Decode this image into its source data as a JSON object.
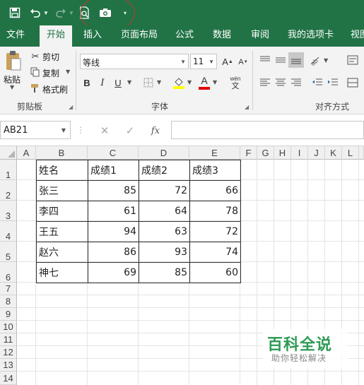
{
  "quick_access": {
    "save_icon": "save-icon",
    "undo_icon": "undo-icon",
    "redo_icon": "redo-icon",
    "print_preview_icon": "print-preview-icon",
    "camera_icon": "camera-icon",
    "customize_icon": "customize-qat-icon"
  },
  "tabs": [
    "文件",
    "开始",
    "插入",
    "页面布局",
    "公式",
    "数据",
    "审阅",
    "我的选项卡",
    "视图"
  ],
  "active_tab": "开始",
  "ribbon": {
    "clipboard": {
      "label": "剪贴板",
      "paste": "粘贴",
      "cut": "剪切",
      "copy": "复制",
      "format_painter": "格式刷"
    },
    "font": {
      "label": "字体",
      "font_name": "等线",
      "font_size": "11",
      "bold": "B",
      "italic": "I",
      "underline": "U",
      "wen": "wén"
    },
    "alignment": {
      "label": "对齐方式"
    }
  },
  "formula_bar": {
    "name_box": "AB21",
    "cancel": "✕",
    "enter": "✓",
    "fx": "fx",
    "value": ""
  },
  "columns": [
    "A",
    "B",
    "C",
    "D",
    "E",
    "F",
    "G",
    "H",
    "I",
    "J",
    "K",
    "L"
  ],
  "rows": [
    "1",
    "2",
    "3",
    "4",
    "5",
    "6",
    "7",
    "8",
    "9",
    "10",
    "11",
    "12",
    "13",
    "14"
  ],
  "table": [
    [
      "姓名",
      "成绩1",
      "成绩2",
      "成绩3"
    ],
    [
      "张三",
      "85",
      "72",
      "66"
    ],
    [
      "李四",
      "61",
      "64",
      "78"
    ],
    [
      "王五",
      "94",
      "63",
      "72"
    ],
    [
      "赵六",
      "86",
      "93",
      "74"
    ],
    [
      "神七",
      "69",
      "85",
      "60"
    ]
  ],
  "watermark": {
    "title": "百科全说",
    "subtitle": "助你轻松解决"
  },
  "colors": {
    "brand_green": "#217346",
    "highlight_yellow": "#ffff00",
    "font_red": "#e00000",
    "annotation_red": "#c0392b"
  }
}
